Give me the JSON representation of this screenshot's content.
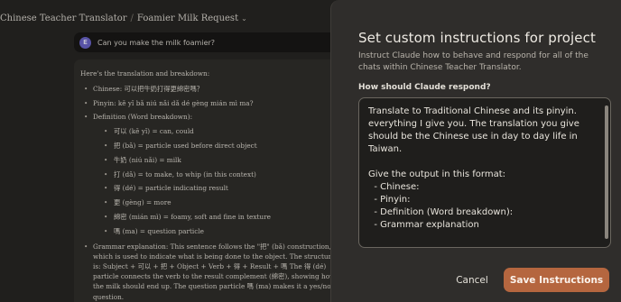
{
  "breadcrumb": {
    "project": "Chinese Teacher Translator",
    "chat": "Foamier Milk Request"
  },
  "user_message": {
    "avatar_initial": "E",
    "text": "Can you make the milk foamier?"
  },
  "response": {
    "intro": "Here's the translation and breakdown:",
    "chinese": "Chinese: 可以把牛奶打得更綿密嗎？",
    "pinyin": "Pinyin: kě yǐ bǎ niú nǎi dǎ dé gèng mián mì ma?",
    "definition_title": "Definition (Word breakdown):",
    "words": [
      "可以 (kě yǐ) = can, could",
      "把 (bǎ) = particle used before direct object",
      "牛奶 (niú nǎi) = milk",
      "打 (dǎ) = to make, to whip (in this context)",
      "得 (dé) = particle indicating result",
      "更 (gèng) = more",
      "綿密 (mián mì) = foamy, soft and fine in texture",
      "嗎 (ma) = question particle"
    ],
    "grammar": "Grammar explanation: This sentence follows the \"把\" (bǎ) construction, which is used to indicate what is being done to the object. The structure is: Subject + 可以 + 把 + Object + Verb + 得 + Result + 嗎 The 得 (dé) particle connects the verb to the result complement (綿密), showing how the milk should end up. The question particle 嗎 (ma) makes it a yes/no question."
  },
  "modal": {
    "title": "Set custom instructions for project",
    "description": "Instruct Claude how to behave and respond for all of the chats within Chinese Teacher Translator.",
    "field_label": "How should Claude respond?",
    "instructions": "Translate to Traditional Chinese and its pinyin. everything I give you. The translation you give should be the Chinese use in day to day life in Taiwan.\n\nGive the output in this format:\n  - Chinese:\n  - Pinyin:\n  - Definition (Word breakdown):\n  - Grammar explanation",
    "cancel_label": "Cancel",
    "save_label": "Save Instructions"
  },
  "icons": {
    "breadcrumb_dropdown": "chevron-down-icon"
  },
  "colors": {
    "accent": "#b5663f",
    "avatar": "#6a63c8"
  }
}
